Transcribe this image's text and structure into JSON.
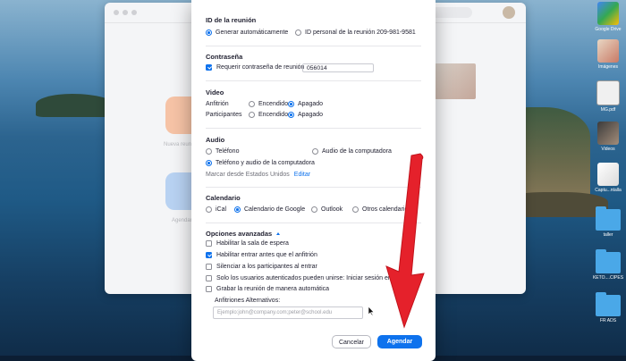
{
  "desktop": {
    "dock_labels": [
      "Google Drive",
      "Imágenes",
      "MG.pdf",
      "Videos",
      "Captu...ntalla",
      "taller",
      "KETO....CIPES",
      "FR ADS"
    ]
  },
  "background_window": {
    "captions": [
      "Nueva reunión",
      "Agendar"
    ]
  },
  "dialog": {
    "meeting_id": {
      "title": "ID de la reunión",
      "opt_auto": "Generar automáticamente",
      "opt_personal": "ID personal de la reunión 209-981-9581"
    },
    "password": {
      "title": "Contraseña",
      "require_label": "Requerir contraseña de reunión",
      "value": "056014"
    },
    "video": {
      "title": "Video",
      "host_label": "Anfitrión",
      "participants_label": "Participantes",
      "on": "Encendido",
      "off": "Apagado"
    },
    "audio": {
      "title": "Audio",
      "phone": "Teléfono",
      "computer": "Audio de la computadora",
      "both": "Teléfono y audio de la computadora",
      "dial_from": "Marcar desde Estados Unidos",
      "edit": "Editar"
    },
    "calendar": {
      "title": "Calendario",
      "ical": "iCal",
      "google": "Calendario de Google",
      "outlook": "Outlook",
      "other": "Otros calendarios"
    },
    "advanced": {
      "title": "Opciones avanzadas",
      "waiting_room": "Habilitar la sala de espera",
      "join_before_host": "Habilitar entrar antes que el anfitrión",
      "mute_on_entry": "Silenciar a los participantes al entrar",
      "auth_only": "Solo los usuarios autenticados pueden unirse: Iniciar sesión en Zoom",
      "auto_record": "Grabar la reunión de manera automática",
      "alt_hosts_label": "Anfitriones Alternativos:",
      "alt_hosts_placeholder": "Ejemplo:john@company.com;peter@school.edu"
    },
    "buttons": {
      "cancel": "Cancelar",
      "schedule": "Agendar"
    }
  },
  "colors": {
    "accent": "#0e72ed",
    "arrow": "#e5212b"
  }
}
